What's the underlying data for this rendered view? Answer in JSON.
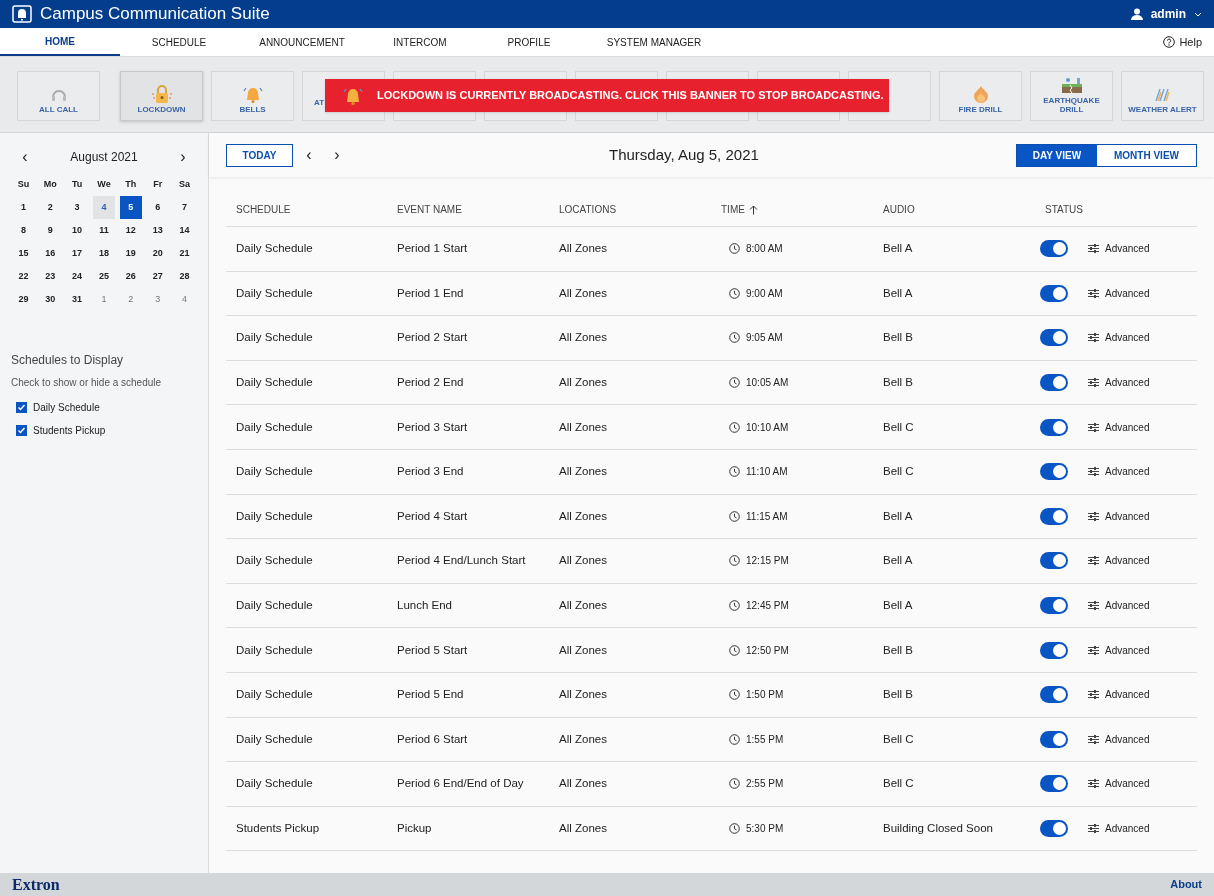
{
  "app": {
    "title": "Campus Communication Suite",
    "user": "admin"
  },
  "nav": {
    "tabs": [
      {
        "label": "HOME",
        "selected": true
      },
      {
        "label": "SCHEDULE",
        "selected": false
      },
      {
        "label": "ANNOUNCEMENT",
        "selected": false
      },
      {
        "label": "INTERCOM",
        "selected": false
      },
      {
        "label": "PROFILE",
        "selected": false
      },
      {
        "label": "SYSTEM MANAGER",
        "selected": false
      }
    ],
    "help": "Help"
  },
  "toolbar": {
    "tiles": [
      {
        "kind": "phone",
        "lines": [
          "ALL CALL"
        ],
        "selected": false
      },
      {
        "kind": "lock",
        "lines": [
          "LOCKDOWN"
        ],
        "selected": true
      },
      {
        "kind": "bell",
        "lines": [
          "BELLS"
        ],
        "selected": false
      },
      {
        "kind": "covered",
        "lines": [
          "AT"
        ],
        "selected": false
      },
      {
        "kind": "covered",
        "selected": false
      },
      {
        "kind": "covered",
        "selected": false
      },
      {
        "kind": "covered",
        "selected": false
      },
      {
        "kind": "covered",
        "selected": false
      },
      {
        "kind": "covered",
        "selected": false
      },
      {
        "kind": "covered",
        "selected": false
      },
      {
        "kind": "fire",
        "lines": [
          "FIRE DRILL"
        ],
        "selected": false
      },
      {
        "kind": "quake",
        "lines": [
          "EARTHQUAKE",
          "DRILL"
        ],
        "selected": false
      },
      {
        "kind": "weather",
        "lines": [
          "WEATHER ALERT"
        ],
        "selected": false
      }
    ],
    "banner": "LOCKDOWN IS CURRENTLY BROADCASTING. CLICK THIS BANNER TO STOP BROADCASTING."
  },
  "calendar": {
    "prev": "‹",
    "month": "August 2021",
    "next": "›",
    "weekdays": [
      "Su",
      "Mo",
      "Tu",
      "We",
      "Th",
      "Fr",
      "Sa"
    ],
    "days": [
      {
        "label": "1",
        "muted": false,
        "today": false,
        "selected": false
      },
      {
        "label": "2",
        "muted": false,
        "today": false,
        "selected": false
      },
      {
        "label": "3",
        "muted": false,
        "today": false,
        "selected": false
      },
      {
        "label": "4",
        "muted": false,
        "today": true,
        "selected": false
      },
      {
        "label": "5",
        "muted": false,
        "today": false,
        "selected": true
      },
      {
        "label": "6",
        "muted": false,
        "today": false,
        "selected": false
      },
      {
        "label": "7",
        "muted": false,
        "today": false,
        "selected": false
      },
      {
        "label": "8",
        "muted": false,
        "today": false,
        "selected": false
      },
      {
        "label": "9",
        "muted": false,
        "today": false,
        "selected": false
      },
      {
        "label": "10",
        "muted": false,
        "today": false,
        "selected": false
      },
      {
        "label": "11",
        "muted": false,
        "today": false,
        "selected": false
      },
      {
        "label": "12",
        "muted": false,
        "today": false,
        "selected": false
      },
      {
        "label": "13",
        "muted": false,
        "today": false,
        "selected": false
      },
      {
        "label": "14",
        "muted": false,
        "today": false,
        "selected": false
      },
      {
        "label": "15",
        "muted": false,
        "today": false,
        "selected": false
      },
      {
        "label": "16",
        "muted": false,
        "today": false,
        "selected": false
      },
      {
        "label": "17",
        "muted": false,
        "today": false,
        "selected": false
      },
      {
        "label": "18",
        "muted": false,
        "today": false,
        "selected": false
      },
      {
        "label": "19",
        "muted": false,
        "today": false,
        "selected": false
      },
      {
        "label": "20",
        "muted": false,
        "today": false,
        "selected": false
      },
      {
        "label": "21",
        "muted": false,
        "today": false,
        "selected": false
      },
      {
        "label": "22",
        "muted": false,
        "today": false,
        "selected": false
      },
      {
        "label": "23",
        "muted": false,
        "today": false,
        "selected": false
      },
      {
        "label": "24",
        "muted": false,
        "today": false,
        "selected": false
      },
      {
        "label": "25",
        "muted": false,
        "today": false,
        "selected": false
      },
      {
        "label": "26",
        "muted": false,
        "today": false,
        "selected": false
      },
      {
        "label": "27",
        "muted": false,
        "today": false,
        "selected": false
      },
      {
        "label": "28",
        "muted": false,
        "today": false,
        "selected": false
      },
      {
        "label": "29",
        "muted": false,
        "today": false,
        "selected": false
      },
      {
        "label": "30",
        "muted": false,
        "today": false,
        "selected": false
      },
      {
        "label": "31",
        "muted": false,
        "today": false,
        "selected": false
      },
      {
        "label": "1",
        "muted": true,
        "today": false,
        "selected": false
      },
      {
        "label": "2",
        "muted": true,
        "today": false,
        "selected": false
      },
      {
        "label": "3",
        "muted": true,
        "today": false,
        "selected": false
      },
      {
        "label": "4",
        "muted": true,
        "today": false,
        "selected": false
      }
    ]
  },
  "schedules": {
    "title": "Schedules to Display",
    "hint": "Check to show or hide a schedule",
    "items": [
      {
        "label": "Daily Schedule",
        "checked": true
      },
      {
        "label": "Students Pickup",
        "checked": true
      }
    ]
  },
  "main": {
    "today": "TODAY",
    "prev": "‹",
    "next": "›",
    "date": "Thursday, Aug 5, 2021",
    "views": [
      {
        "label": "DAY VIEW",
        "selected": true
      },
      {
        "label": "MONTH VIEW",
        "selected": false
      }
    ]
  },
  "table": {
    "columns": [
      "SCHEDULE",
      "EVENT NAME",
      "LOCATIONS",
      "TIME",
      "AUDIO",
      "STATUS"
    ],
    "rows": [
      {
        "schedule": "Daily Schedule",
        "event": "Period 1 Start",
        "location": "All Zones",
        "time": "8:00 AM",
        "audio": "Bell A",
        "on": true,
        "action": "Advanced"
      },
      {
        "schedule": "Daily Schedule",
        "event": "Period 1 End",
        "location": "All Zones",
        "time": "9:00 AM",
        "audio": "Bell A",
        "on": true,
        "action": "Advanced"
      },
      {
        "schedule": "Daily Schedule",
        "event": "Period 2 Start",
        "location": "All Zones",
        "time": "9:05 AM",
        "audio": "Bell B",
        "on": true,
        "action": "Advanced"
      },
      {
        "schedule": "Daily Schedule",
        "event": "Period 2 End",
        "location": "All Zones",
        "time": "10:05 AM",
        "audio": "Bell B",
        "on": true,
        "action": "Advanced"
      },
      {
        "schedule": "Daily Schedule",
        "event": "Period 3 Start",
        "location": "All Zones",
        "time": "10:10 AM",
        "audio": "Bell C",
        "on": true,
        "action": "Advanced"
      },
      {
        "schedule": "Daily Schedule",
        "event": "Period 3 End",
        "location": "All Zones",
        "time": "11:10 AM",
        "audio": "Bell C",
        "on": true,
        "action": "Advanced"
      },
      {
        "schedule": "Daily Schedule",
        "event": "Period 4 Start",
        "location": "All Zones",
        "time": "11:15 AM",
        "audio": "Bell A",
        "on": true,
        "action": "Advanced"
      },
      {
        "schedule": "Daily Schedule",
        "event": "Period 4 End/Lunch Start",
        "location": "All Zones",
        "time": "12:15 PM",
        "audio": "Bell A",
        "on": true,
        "action": "Advanced"
      },
      {
        "schedule": "Daily Schedule",
        "event": "Lunch End",
        "location": "All Zones",
        "time": "12:45 PM",
        "audio": "Bell A",
        "on": true,
        "action": "Advanced"
      },
      {
        "schedule": "Daily Schedule",
        "event": "Period 5 Start",
        "location": "All Zones",
        "time": "12:50 PM",
        "audio": "Bell B",
        "on": true,
        "action": "Advanced"
      },
      {
        "schedule": "Daily Schedule",
        "event": "Period 5 End",
        "location": "All Zones",
        "time": "1:50 PM",
        "audio": "Bell B",
        "on": true,
        "action": "Advanced"
      },
      {
        "schedule": "Daily Schedule",
        "event": "Period 6 Start",
        "location": "All Zones",
        "time": "1:55 PM",
        "audio": "Bell C",
        "on": true,
        "action": "Advanced"
      },
      {
        "schedule": "Daily Schedule",
        "event": "Period 6 End/End of Day",
        "location": "All Zones",
        "time": "2:55 PM",
        "audio": "Bell C",
        "on": true,
        "action": "Advanced"
      },
      {
        "schedule": "Students Pickup",
        "event": "Pickup",
        "location": "All Zones",
        "time": "5:30 PM",
        "audio": "Building Closed Soon",
        "on": true,
        "action": "Advanced"
      }
    ]
  },
  "footer": {
    "brand": "Extron",
    "about": "About"
  }
}
